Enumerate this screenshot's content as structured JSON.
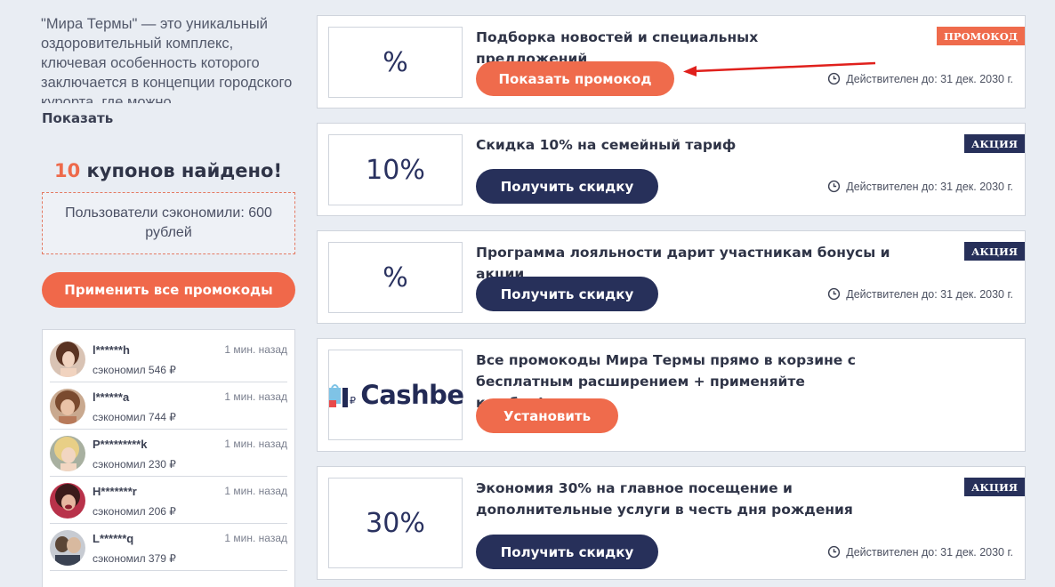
{
  "sidebar": {
    "description": "\"Мира Термы\" — это уникальный оздоровительный комплекс, ключевая особенность которого заключается в концепции городского курорта, где можно",
    "show_more": "Показать",
    "found_count": "10",
    "found_text": " купонов найдено!",
    "saved_text": "Пользователи сэкономили: 600 рублей",
    "apply_all": "Применить все промокоды",
    "activity": [
      {
        "name": "l******h",
        "time": "1 мин. назад",
        "saved": "сэкономил 546 ₽"
      },
      {
        "name": "l******a",
        "time": "1 мин. назад",
        "saved": "сэкономил 744 ₽"
      },
      {
        "name": "P*********k",
        "time": "1 мин. назад",
        "saved": "сэкономил 230 ₽"
      },
      {
        "name": "H*******r",
        "time": "1 мин. назад",
        "saved": "сэкономил 206 ₽"
      },
      {
        "name": "L******q",
        "time": "1 мин. назад",
        "saved": "сэкономил 379 ₽"
      }
    ]
  },
  "coupons": [
    {
      "image_text": "%",
      "title": "Подборка новостей и специальных предложений",
      "badge": "ПРОМОКОД",
      "button": "Показать промокод",
      "valid": "Действителен до: 31 дек. 2030 г."
    },
    {
      "image_text": "10%",
      "title": "Скидка 10% на семейный тариф",
      "badge": "АКЦИЯ",
      "button": "Получить скидку",
      "valid": "Действителен до: 31 дек. 2030 г."
    },
    {
      "image_text": "%",
      "title": "Программа лояльности дарит участникам бонусы и акции",
      "badge": "АКЦИЯ",
      "button": "Получить скидку",
      "valid": "Действителен до: 31 дек. 2030 г."
    },
    {
      "image_text": "Cashbe",
      "title": "Все промокоды Мира Термы прямо в корзине с бесплатным расширением + применяйте кешбек!",
      "button": "Установить"
    },
    {
      "image_text": "30%",
      "title": "Экономия 30% на главное посещение и дополнительные услуги в честь дня рождения",
      "badge": "АКЦИЯ",
      "button": "Получить скидку",
      "valid": "Действителен до: 31 дек. 2030 г."
    }
  ],
  "colors": {
    "accent": "#ef6b4c",
    "navy": "#27305a",
    "background": "#e9edf3"
  },
  "icons": [
    "clock-icon",
    "arrow-icon",
    "cashbe-logo"
  ]
}
